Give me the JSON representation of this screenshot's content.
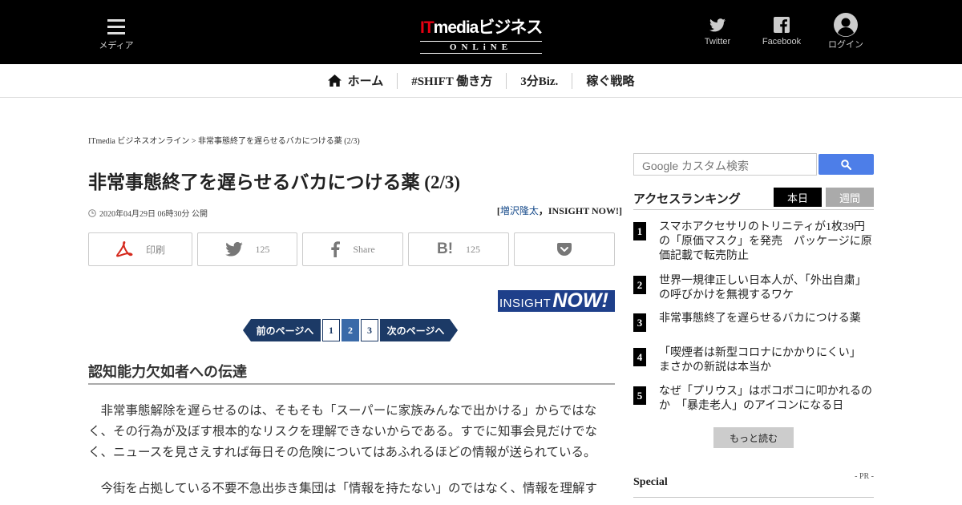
{
  "header": {
    "menu_label": "メディア",
    "logo_it": "IT",
    "logo_media": "mediaビジネス",
    "logo_online": "ONLiNE",
    "twitter_label": "Twitter",
    "facebook_label": "Facebook",
    "login_label": "ログイン"
  },
  "nav": {
    "items": [
      {
        "label": "ホーム"
      },
      {
        "label": "#SHIFT 働き方"
      },
      {
        "label": "3分Biz."
      },
      {
        "label": "稼ぐ戦略"
      }
    ]
  },
  "article": {
    "breadcrumb": "ITmedia ビジネスオンライン > 非常事態終了を遅らせるバカにつける薬 (2/3)",
    "title": "非常事態終了を遅らせるバカにつける薬 (2/3)",
    "date": "2020年04月29日 06時30分 公開",
    "author_open": "[",
    "author_name": "増沢隆太",
    "author_rest": "，INSIGHT NOW!]",
    "share": {
      "print_label": "印刷",
      "twitter_count": "125",
      "facebook_label": "Share",
      "hatena_count": "125"
    },
    "insight_logo_a": "INSIGHT",
    "insight_logo_b": "NOW!",
    "pager": {
      "prev": "前のページへ",
      "pages": [
        "1",
        "2",
        "3"
      ],
      "current": "2",
      "next": "次のページへ"
    },
    "section_heading": "認知能力欠如者への伝達",
    "paragraphs": [
      "非常事態解除を遅らせるのは、そもそも「スーパーに家族みんなで出かける」からではなく、その行為が及ぼす根本的なリスクを理解できないからである。すでに知事会見だけでなく、ニュースを見さえすれば毎日その危険についてはあふれるほどの情報が送られている。",
      "今街を占拠している不要不急出歩き集団は「情報を持たない」のではなく、情報を理解す"
    ]
  },
  "sidebar": {
    "search_placeholder": "Google カスタム検索",
    "ranking_title": "アクセスランキング",
    "tab_today": "本日",
    "tab_week": "週間",
    "ranking": [
      {
        "rank": "1",
        "text": "スマホアクセサリのトリニティが1枚39円の「原価マスク」を発売　パッケージに原価記載で転売防止"
      },
      {
        "rank": "2",
        "text": "世界一規律正しい日本人が、「外出自粛」の呼びかけを無視するワケ"
      },
      {
        "rank": "3",
        "text": "非常事態終了を遅らせるバカにつける薬"
      },
      {
        "rank": "4",
        "text": "「喫煙者は新型コロナにかかりにくい」　まさかの新説は本当か"
      },
      {
        "rank": "5",
        "text": "なぜ「プリウス」はボコボコに叩かれるのか　「暴走老人」のアイコンになる日"
      }
    ],
    "more_label": "もっと読む",
    "special_title": "Special",
    "pr_label": "- PR -"
  }
}
